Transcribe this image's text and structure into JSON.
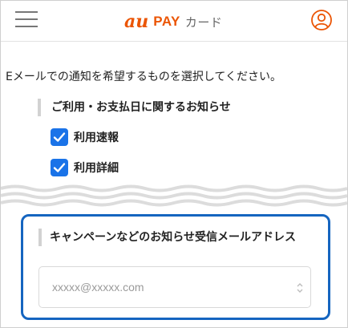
{
  "header": {
    "logo_au": "au",
    "logo_pay": "PAY",
    "logo_card": "カード",
    "menu_icon": "hamburger-menu-icon",
    "user_icon": "user-account-icon"
  },
  "intro_text": "Eメールでの通知を希望するものを選択してください。",
  "usage_section": {
    "heading": "ご利用・お支払日に関するお知らせ",
    "options": [
      {
        "label": "利用速報",
        "checked": true
      },
      {
        "label": "利用詳細",
        "checked": true
      }
    ]
  },
  "campaign_section": {
    "heading": "キャンペーンなどのお知らせ受信メールアドレス",
    "email_placeholder": "xxxxx@xxxxx.com"
  },
  "colors": {
    "brand": "#eb5505",
    "checkbox": "#1a73e8",
    "highlight_border": "#1565c0",
    "wave": "#dcdcdc"
  }
}
